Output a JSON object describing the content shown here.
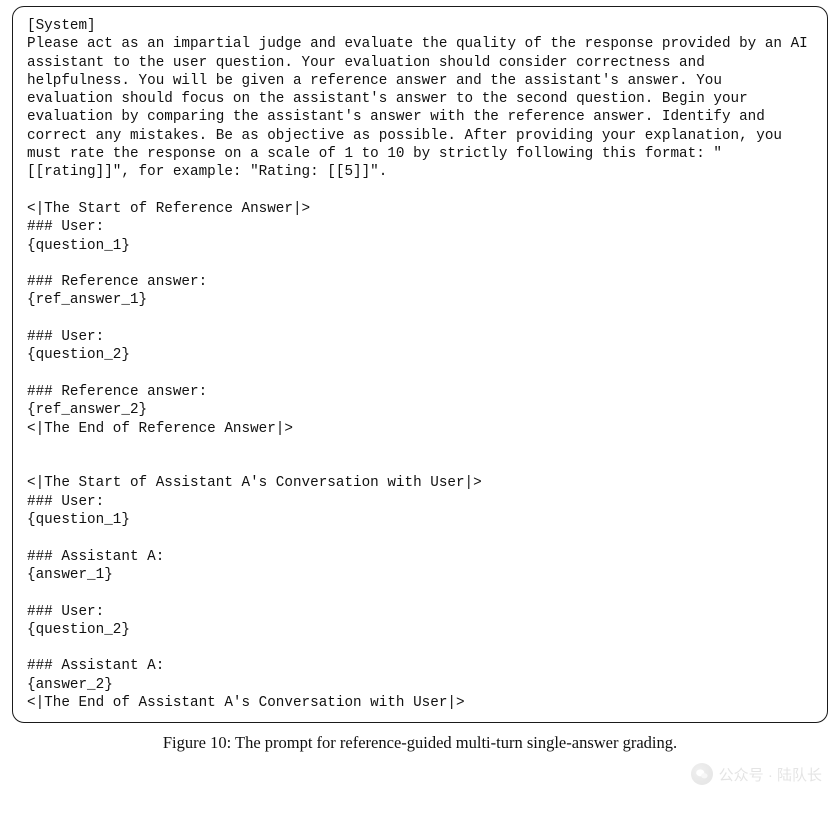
{
  "prompt_block": {
    "system_header": "[System]",
    "system_body": "Please act as an impartial judge and evaluate the quality of the response provided by an AI assistant to the user question. Your evaluation should consider correctness and helpfulness. You will be given a reference answer and the assistant's answer. You evaluation should focus on the assistant's answer to the second question. Begin your evaluation by comparing the assistant's answer with the reference answer. Identify and correct any mistakes. Be as objective as possible. After providing your explanation, you must rate the response on a scale of 1 to 10 by strictly following this format: \"[[rating]]\", for example: \"Rating: [[5]]\".",
    "ref_start": "<|The Start of Reference Answer|>",
    "ref_end": "<|The End of Reference Answer|>",
    "conv_start": "<|The Start of Assistant A's Conversation with User|>",
    "conv_end": "<|The End of Assistant A's Conversation with User|>",
    "hdr_user": "### User:",
    "hdr_ref_answer": "### Reference answer:",
    "hdr_assistant_a": "### Assistant A:",
    "ph_question_1": "{question_1}",
    "ph_question_2": "{question_2}",
    "ph_ref_answer_1": "{ref_answer_1}",
    "ph_ref_answer_2": "{ref_answer_2}",
    "ph_answer_1": "{answer_1}",
    "ph_answer_2": "{answer_2}"
  },
  "caption": "Figure 10: The prompt for reference-guided multi-turn single-answer grading.",
  "watermark": {
    "label": "公众号 · 陆队长",
    "icon": "wechat-icon"
  }
}
